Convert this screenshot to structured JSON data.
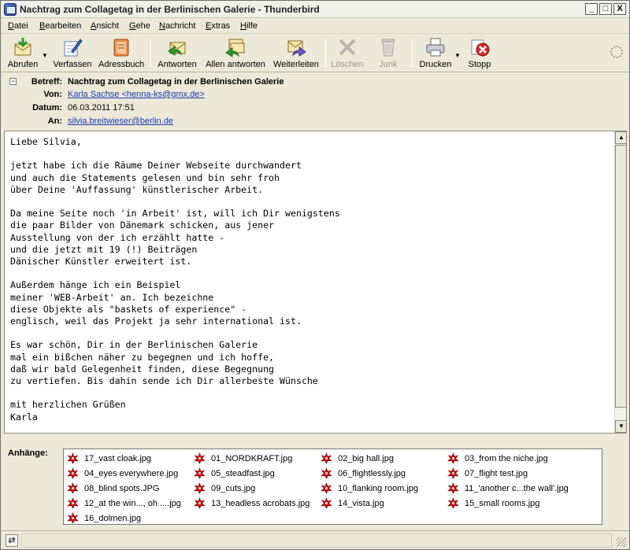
{
  "window": {
    "title": "Nachtrag zum Collagetag in der Berlinischen Galerie - Thunderbird",
    "minimize_glyph": "_",
    "maximize_glyph": "□",
    "close_glyph": "X"
  },
  "menu": [
    "Datei",
    "Bearbeiten",
    "Ansicht",
    "Gehe",
    "Nachricht",
    "Extras",
    "Hilfe"
  ],
  "toolbar": {
    "abrufen": "Abrufen",
    "verfassen": "Verfassen",
    "adressbuch": "Adressbuch",
    "antworten": "Antworten",
    "allen_antworten": "Allen antworten",
    "weiterleiten": "Weiterleiten",
    "loeschen": "Löschen",
    "junk": "Junk",
    "drucken": "Drucken",
    "stopp": "Stopp"
  },
  "header": {
    "subject_label": "Betreff:",
    "subject": "Nachtrag zum Collagetag in der Berlinischen Galerie",
    "from_label": "Von:",
    "from": "Karla Sachse <henna-ks@gmx.de>",
    "date_label": "Datum:",
    "date": "06.03.2011 17:51",
    "to_label": "An:",
    "to": "silvia.breitwieser@berlin.de"
  },
  "body": "Liebe Silvia,\n\njetzt habe ich die Räume Deiner Webseite durchwandert\nund auch die Statements gelesen und bin sehr froh\nüber Deine 'Auffassung' künstlerischer Arbeit.\n\nDa meine Seite noch 'in Arbeit' ist, will ich Dir wenigstens\ndie paar Bilder von Dänemark schicken, aus jener\nAusstellung von der ich erzählt hatte -\nund die jetzt mit 19 (!) Beiträgen\nDänischer Künstler erweitert ist.\n\nAußerdem hänge ich ein Beispiel\nmeiner 'WEB-Arbeit' an. Ich bezeichne\ndiese Objekte als \"baskets of experience\" -\nenglisch, weil das Projekt ja sehr international ist.\n\nEs war schön, Dir in der Berlinischen Galerie\nmal ein bißchen näher zu begegnen und ich hoffe,\ndaß wir bald Gelegenheit finden, diese Begegnung\nzu vertiefen. Bis dahin sende ich Dir allerbeste Wünsche\n\nmit herzlichen Grüßen\nKarla",
  "attachments_label": "Anhänge:",
  "attachments": [
    "17_vast cloak.jpg",
    "01_NORDKRAFT.jpg",
    "02_big hall.jpg",
    "03_from the niche.jpg",
    "04_eyes everywhere.jpg",
    "05_steadfast.jpg",
    "06_flightlessly.jpg",
    "07_flight test.jpg",
    "08_blind spots.JPG",
    "09_cuts.jpg",
    "10_flanking room.jpg",
    "11_'another c...the wall'.jpg",
    "12_at the win..., oh ....jpg",
    "13_headless acrobats.jpg",
    "14_vista.jpg",
    "15_small rooms.jpg",
    "16_dolmen.jpg"
  ],
  "icons": {
    "abrufen": "get-mail-icon",
    "verfassen": "compose-icon",
    "adressbuch": "address-book-icon",
    "antworten": "reply-icon",
    "allen_antworten": "reply-all-icon",
    "weiterleiten": "forward-icon",
    "loeschen": "delete-icon",
    "junk": "junk-icon",
    "drucken": "print-icon",
    "stopp": "stop-icon",
    "attachment": "image-attachment-icon"
  },
  "colors": {
    "link": "#1c3bb0",
    "attachment_icon": "#cc1111",
    "disabled_text": "#9a9a90"
  }
}
